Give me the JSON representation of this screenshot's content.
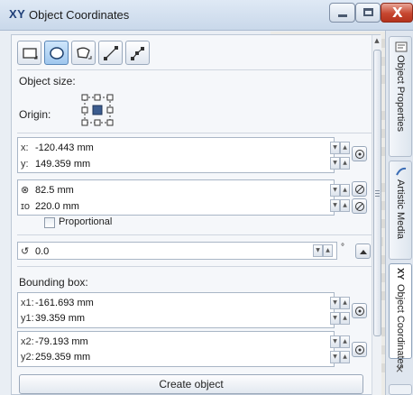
{
  "window": {
    "icon_text": "XY",
    "title": "Object Coordinates",
    "close_glyph": "X"
  },
  "toolbar": {
    "tools": [
      {
        "name": "rectangle-tool",
        "active": false
      },
      {
        "name": "ellipse-tool",
        "active": true
      },
      {
        "name": "polygon-tool",
        "active": false
      },
      {
        "name": "line-tool",
        "active": false
      },
      {
        "name": "curve-tool",
        "active": false
      }
    ]
  },
  "object_size": {
    "heading": "Object size:",
    "origin_label": "Origin:"
  },
  "position": {
    "x_label": "x:",
    "x_value": "-120.443 mm",
    "y_label": "y:",
    "y_value": "149.359 mm"
  },
  "size": {
    "width_value": "82.5 mm",
    "height_value": "220.0 mm",
    "proportional_label": "Proportional",
    "proportional_checked": false
  },
  "rotation": {
    "value": "0.0",
    "unit": "°"
  },
  "bounding_box": {
    "heading": "Bounding box:",
    "x1_label": "x1:",
    "x1_value": "-161.693 mm",
    "y1_label": "y1:",
    "y1_value": "39.359 mm",
    "x2_label": "x2:",
    "x2_value": "-79.193 mm",
    "y2_label": "y2:",
    "y2_value": "259.359 mm"
  },
  "actions": {
    "create_label": "Create object"
  },
  "dock": {
    "tabs": [
      {
        "label": "Object Properties",
        "icon": "object-properties-icon"
      },
      {
        "label": "Artistic Media",
        "icon": "artistic-media-icon"
      },
      {
        "label": "Object Coordinates",
        "icon": "xy-icon",
        "icon_text": "XY"
      }
    ],
    "close_glyph": "×"
  },
  "colors": {
    "accent": "#9fc7ee",
    "close_button": "#c6462f",
    "title_bar": "#c9d8ea"
  }
}
